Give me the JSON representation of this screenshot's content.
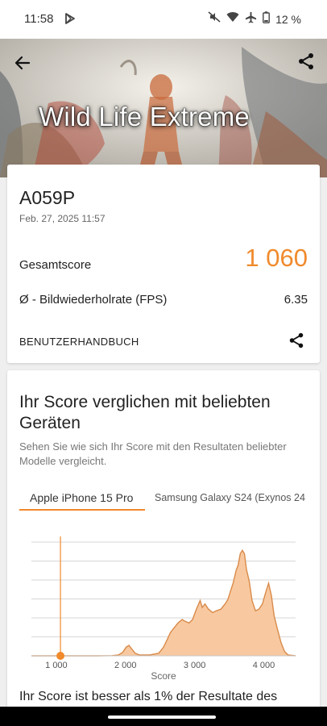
{
  "status_bar": {
    "time": "11:58",
    "battery_percent": "12 %"
  },
  "hero": {
    "title": "Wild Life Extreme"
  },
  "result": {
    "device": "A059P",
    "date": "Feb. 27, 2025 11:57",
    "score_label": "Gesamtscore",
    "score_value": "1 060",
    "fps_label": "Ø - Bildwiederholrate (FPS)",
    "fps_value": "6.35",
    "manual_label": "BENUTZERHANDBUCH"
  },
  "compare": {
    "title": "Ihr Score verglichen mit beliebten Geräten",
    "subtitle": "Sehen Sie wie sich Ihr Score mit den Resultaten beliebter Modelle vergleicht.",
    "tabs": [
      "Apple iPhone 15 Pro",
      "Samsung Galaxy S24 (Exynos 24"
    ],
    "result_text": "Ihr Score ist besser als 1% der Resultate des"
  },
  "colors": {
    "accent": "#f08a2c",
    "fill": "#f8c9a0",
    "line": "#d98a4a"
  },
  "chart_data": {
    "type": "area",
    "xlabel": "Score",
    "x_ticks": [
      1000,
      2000,
      3000,
      4000
    ],
    "x_tick_labels": [
      "1 000",
      "2 000",
      "3 000",
      "4 000"
    ],
    "xlim": [
      640,
      4460
    ],
    "marker_x": 1060,
    "series": [
      {
        "values": [
          [
            640,
            0
          ],
          [
            900,
            0
          ],
          [
            1300,
            0
          ],
          [
            1600,
            0
          ],
          [
            1800,
            0.2
          ],
          [
            1900,
            1
          ],
          [
            1960,
            4
          ],
          [
            2010,
            10
          ],
          [
            2050,
            12
          ],
          [
            2090,
            8
          ],
          [
            2140,
            3
          ],
          [
            2200,
            1
          ],
          [
            2350,
            1
          ],
          [
            2480,
            3
          ],
          [
            2550,
            10
          ],
          [
            2610,
            20
          ],
          [
            2650,
            27
          ],
          [
            2700,
            32
          ],
          [
            2760,
            38
          ],
          [
            2820,
            42
          ],
          [
            2860,
            40
          ],
          [
            2920,
            38
          ],
          [
            2970,
            42
          ],
          [
            3020,
            53
          ],
          [
            3080,
            64
          ],
          [
            3110,
            56
          ],
          [
            3150,
            60
          ],
          [
            3200,
            54
          ],
          [
            3260,
            50
          ],
          [
            3310,
            52
          ],
          [
            3380,
            54
          ],
          [
            3440,
            60
          ],
          [
            3480,
            65
          ],
          [
            3520,
            75
          ],
          [
            3560,
            85
          ],
          [
            3600,
            99
          ],
          [
            3630,
            105
          ],
          [
            3660,
            118
          ],
          [
            3690,
            122
          ],
          [
            3720,
            118
          ],
          [
            3750,
            100
          ],
          [
            3790,
            86
          ],
          [
            3830,
            64
          ],
          [
            3880,
            52
          ],
          [
            3930,
            54
          ],
          [
            3980,
            60
          ],
          [
            4030,
            74
          ],
          [
            4070,
            84
          ],
          [
            4110,
            70
          ],
          [
            4150,
            46
          ],
          [
            4200,
            30
          ],
          [
            4250,
            15
          ],
          [
            4300,
            5
          ],
          [
            4350,
            1
          ],
          [
            4460,
            0
          ]
        ]
      }
    ]
  }
}
